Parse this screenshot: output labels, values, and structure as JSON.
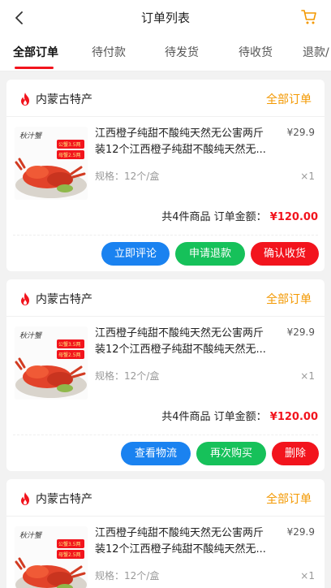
{
  "header": {
    "title": "订单列表",
    "back_icon": "chevron-left-icon",
    "cart_icon": "shopping-cart-icon",
    "cart_color": "#f39800"
  },
  "tabs": [
    {
      "label": "全部订单"
    },
    {
      "label": "待付款"
    },
    {
      "label": "待发货"
    },
    {
      "label": "待收货"
    },
    {
      "label": "退款/"
    }
  ],
  "colors": {
    "accent": "#f2141d",
    "status": "#f39800",
    "blue_btn": "#1a82f0",
    "green_btn": "#16c15a"
  },
  "orders": [
    {
      "store": "内蒙古特产",
      "status": "全部订单",
      "goods": {
        "title": "江西橙子纯甜不酸纯天然无公害两斤装12个江西橙子纯甜不酸纯天然无...",
        "price": "¥29.9",
        "spec": "规格：12个/盒",
        "qty": "×1",
        "img_badge_1": "公蟹3.5两",
        "img_badge_2": "母蟹2.5两",
        "img_brand": "秋汁蟹"
      },
      "summary": {
        "count_text": "共4件商品",
        "amount_label": "订单金额：",
        "amount": "¥120.00"
      },
      "actions": [
        "立即评论",
        "申请退款",
        "确认收货"
      ]
    },
    {
      "store": "内蒙古特产",
      "status": "全部订单",
      "goods": {
        "title": "江西橙子纯甜不酸纯天然无公害两斤装12个江西橙子纯甜不酸纯天然无...",
        "price": "¥29.9",
        "spec": "规格：12个/盒",
        "qty": "×1",
        "img_badge_1": "公蟹3.5两",
        "img_badge_2": "母蟹2.5两",
        "img_brand": "秋汁蟹"
      },
      "summary": {
        "count_text": "共4件商品",
        "amount_label": "订单金额：",
        "amount": "¥120.00"
      },
      "actions": [
        "查看物流",
        "再次购买",
        "删除"
      ]
    },
    {
      "store": "内蒙古特产",
      "status": "全部订单",
      "goods": {
        "title": "江西橙子纯甜不酸纯天然无公害两斤装12个江西橙子纯甜不酸纯天然无...",
        "price": "¥29.9",
        "spec": "规格：12个/盒",
        "qty": "×1",
        "img_badge_1": "公蟹3.5两",
        "img_badge_2": "母蟹2.5两",
        "img_brand": "秋汁蟹"
      }
    }
  ]
}
